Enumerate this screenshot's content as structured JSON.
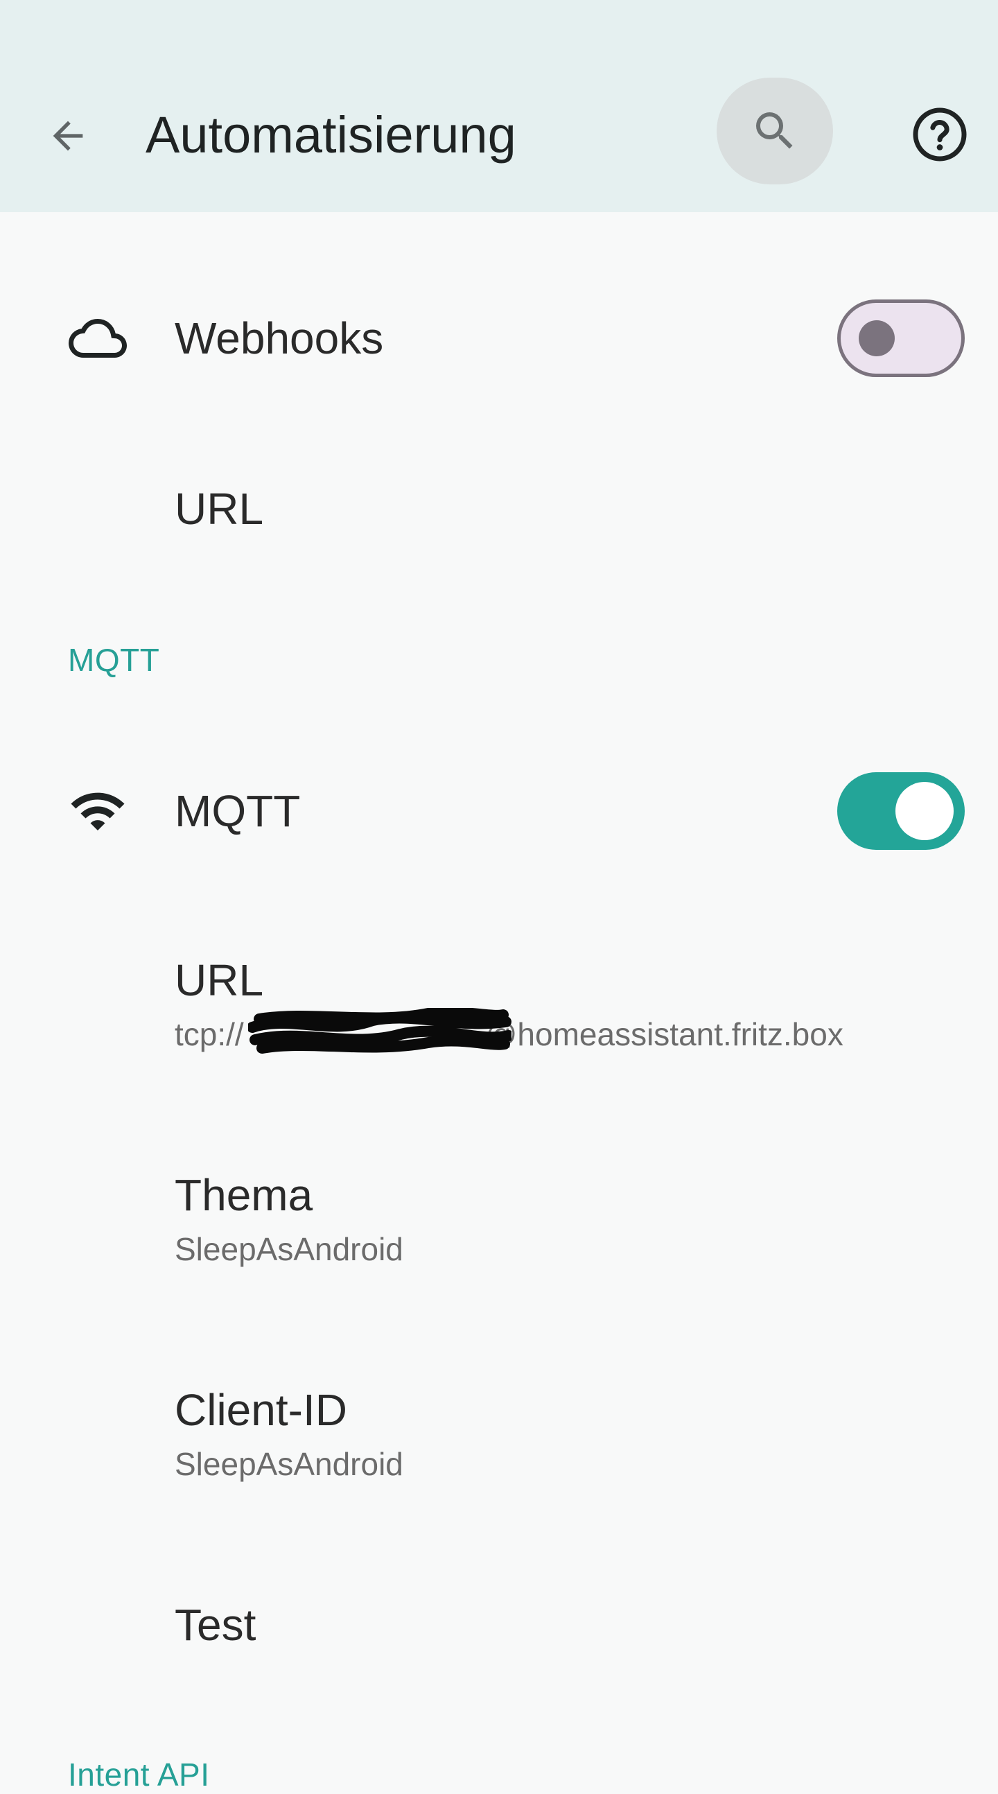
{
  "app_bar": {
    "title": "Automatisierung",
    "back_icon": "arrow-back-icon",
    "search_icon": "search-icon",
    "help_icon": "help-circle-icon"
  },
  "webhooks": {
    "icon": "cloud-icon",
    "label": "Webhooks",
    "enabled": false,
    "url_label": "URL"
  },
  "mqtt_section": {
    "header": "MQTT",
    "toggle": {
      "icon": "wifi-icon",
      "label": "MQTT",
      "enabled": true
    },
    "url": {
      "label": "URL",
      "prefix": "tcp://",
      "suffix": "@homeassistant.fritz.box"
    },
    "topic": {
      "label": "Thema",
      "value": "SleepAsAndroid"
    },
    "client_id": {
      "label": "Client-ID",
      "value": "SleepAsAndroid"
    },
    "test": {
      "label": "Test"
    }
  },
  "intent_section": {
    "header": "Intent API"
  },
  "colors": {
    "accent": "#26a096",
    "switch_on": "#23a598",
    "app_bar_bg": "#e5f0f0"
  }
}
